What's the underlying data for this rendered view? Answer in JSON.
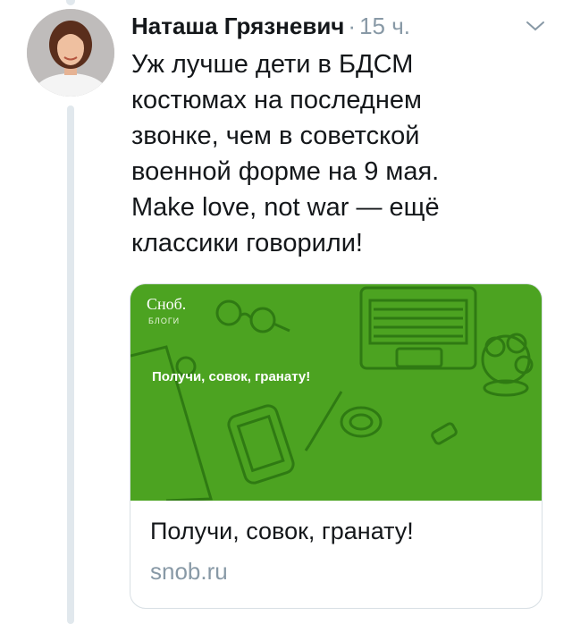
{
  "tweet": {
    "author": "Наташа Грязневич",
    "separator": "·",
    "time": "15 ч.",
    "text": "Уж лучше дети в БДСМ\nкостюмах на последнем\nзвонке, чем в советской\nвоенной форме на 9 мая.\nMake love, not war — ещё\nклассики говорили!"
  },
  "card": {
    "image": {
      "brand": "Сноб.",
      "section": "БЛОГИ",
      "headline": "Получи, совок, гранату!"
    },
    "title": "Получи, совок, гранату!",
    "domain": "snob.ru"
  },
  "colors": {
    "card_green": "#4ca321",
    "muted": "#8899a6",
    "border": "#d8dfe4",
    "thread_line": "#e1e8ed"
  },
  "icons": {
    "more": "chevron-down-icon"
  }
}
